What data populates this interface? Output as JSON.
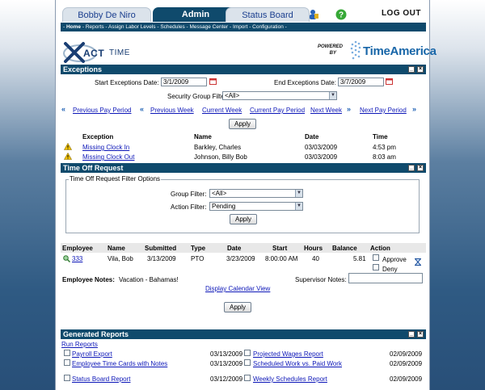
{
  "header": {
    "tabs": [
      {
        "label": "Bobby De Niro",
        "active": false
      },
      {
        "label": "Admin",
        "active": true
      },
      {
        "label": "Status Board",
        "active": false
      }
    ],
    "logout": "LOG OUT",
    "icons": [
      "user-settings-icon",
      "help-icon"
    ]
  },
  "subnav": {
    "items": [
      "Home",
      "Reports",
      "Assign Labor Levels",
      "Schedules",
      "Message Center",
      "Import",
      "Configuration"
    ],
    "separator": " - "
  },
  "brand": {
    "product": "ACT",
    "product_suffix": "TIME",
    "powered": "POWERED",
    "by": "BY",
    "partner": "TimeAmerica"
  },
  "exceptions": {
    "title": "Exceptions",
    "start_label": "Start Exceptions Date:",
    "start_value": "3/1/2009",
    "end_label": "End Exceptions Date:",
    "end_value": "3/7/2009",
    "security_label": "Security Group Filter:",
    "security_value": "<All>",
    "nav": {
      "prev_pay": "Previous Pay Period",
      "prev_week": "Previous Week",
      "current_week": "Current Week",
      "current_pay": "Current Pay Period",
      "next_week": "Next Week",
      "next_pay": "Next Pay Period"
    },
    "apply": "Apply",
    "columns": {
      "exception": "Exception",
      "name": "Name",
      "date": "Date",
      "time": "Time"
    },
    "rows": [
      {
        "exception": "Missing Clock In",
        "name": "Barkley, Charles",
        "date": "03/03/2009",
        "time": "4:53 pm"
      },
      {
        "exception": "Missing Clock Out",
        "name": "Johnson, Billy Bob",
        "date": "03/03/2009",
        "time": "8:03 am"
      }
    ]
  },
  "timeoff": {
    "title": "Time Off Request",
    "legend": "Time Off Request Filter Options",
    "group_label": "Group Filter:",
    "group_value": "<All>",
    "action_label": "Action Filter:",
    "action_value": "Pending",
    "apply": "Apply",
    "columns": {
      "employee": "Employee",
      "name": "Name",
      "submitted": "Submitted",
      "type": "Type",
      "date": "Date",
      "start": "Start",
      "hours": "Hours",
      "balance": "Balance",
      "action": "Action"
    },
    "row": {
      "employee": "333",
      "name": "Vila, Bob",
      "submitted": "3/13/2009",
      "type": "PTO",
      "date": "3/23/2009",
      "start": "8:00:00 AM",
      "hours": "40",
      "balance": "5.81",
      "approve": "Approve",
      "deny": "Deny"
    },
    "employee_notes_label": "Employee Notes:",
    "employee_notes_value": "Vacation - Bahamas!",
    "supervisor_notes_label": "Supervisor Notes:",
    "calendar_link": "Display Calendar View",
    "apply2": "Apply"
  },
  "reports": {
    "title": "Generated Reports",
    "run": "Run Reports",
    "items": [
      {
        "name": "Payroll Export",
        "date": "03/13/2009"
      },
      {
        "name": "Projected Wages Report",
        "date": "02/09/2009"
      },
      {
        "name": "Employee Time Cards with Notes",
        "date": "03/13/2009"
      },
      {
        "name": "Scheduled Work vs. Paid Work",
        "date": "02/09/2009"
      },
      {
        "name": "Status Board Report",
        "date": "03/12/2009"
      },
      {
        "name": "Weekly Schedules Report",
        "date": "02/09/2009"
      }
    ]
  }
}
